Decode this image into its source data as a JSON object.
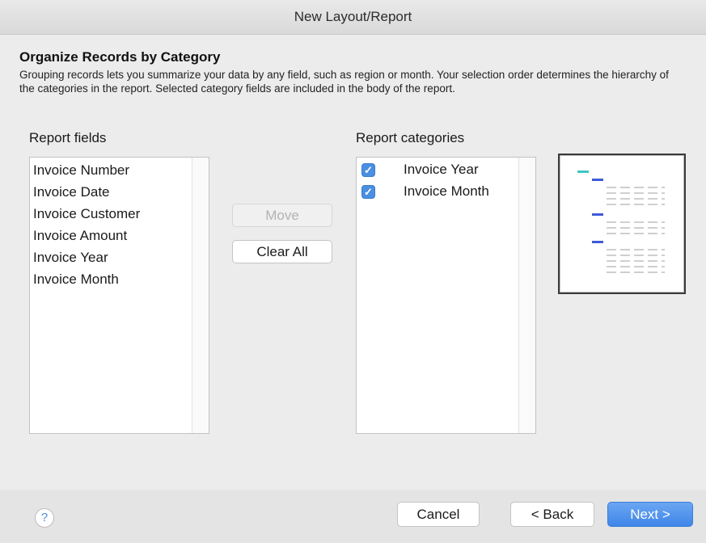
{
  "window": {
    "title": "New Layout/Report"
  },
  "section": {
    "heading": "Organize Records by Category",
    "description": "Grouping records lets you summarize your data by any field, such as region or month. Your selection order determines the hierarchy of the categories in the report. Selected category fields are included in the body of the report."
  },
  "report_fields": {
    "label": "Report fields",
    "items": [
      "Invoice Number",
      "Invoice Date",
      "Invoice Customer",
      "Invoice Amount",
      "Invoice Year",
      "Invoice Month"
    ]
  },
  "buttons": {
    "move": "Move",
    "clear_all": "Clear All"
  },
  "report_categories": {
    "label": "Report categories",
    "items": [
      {
        "label": "Invoice Year",
        "checked": true
      },
      {
        "label": "Invoice Month",
        "checked": true
      }
    ]
  },
  "footer": {
    "help": "?",
    "cancel": "Cancel",
    "back": "< Back",
    "next": "Next >"
  },
  "colors": {
    "accent": "#4a8fe0",
    "preview_teal": "#3fc6c0",
    "preview_blue": "#3d5bd6"
  },
  "icons": {
    "checkbox": "checkmark-icon",
    "help": "question-mark-icon"
  }
}
